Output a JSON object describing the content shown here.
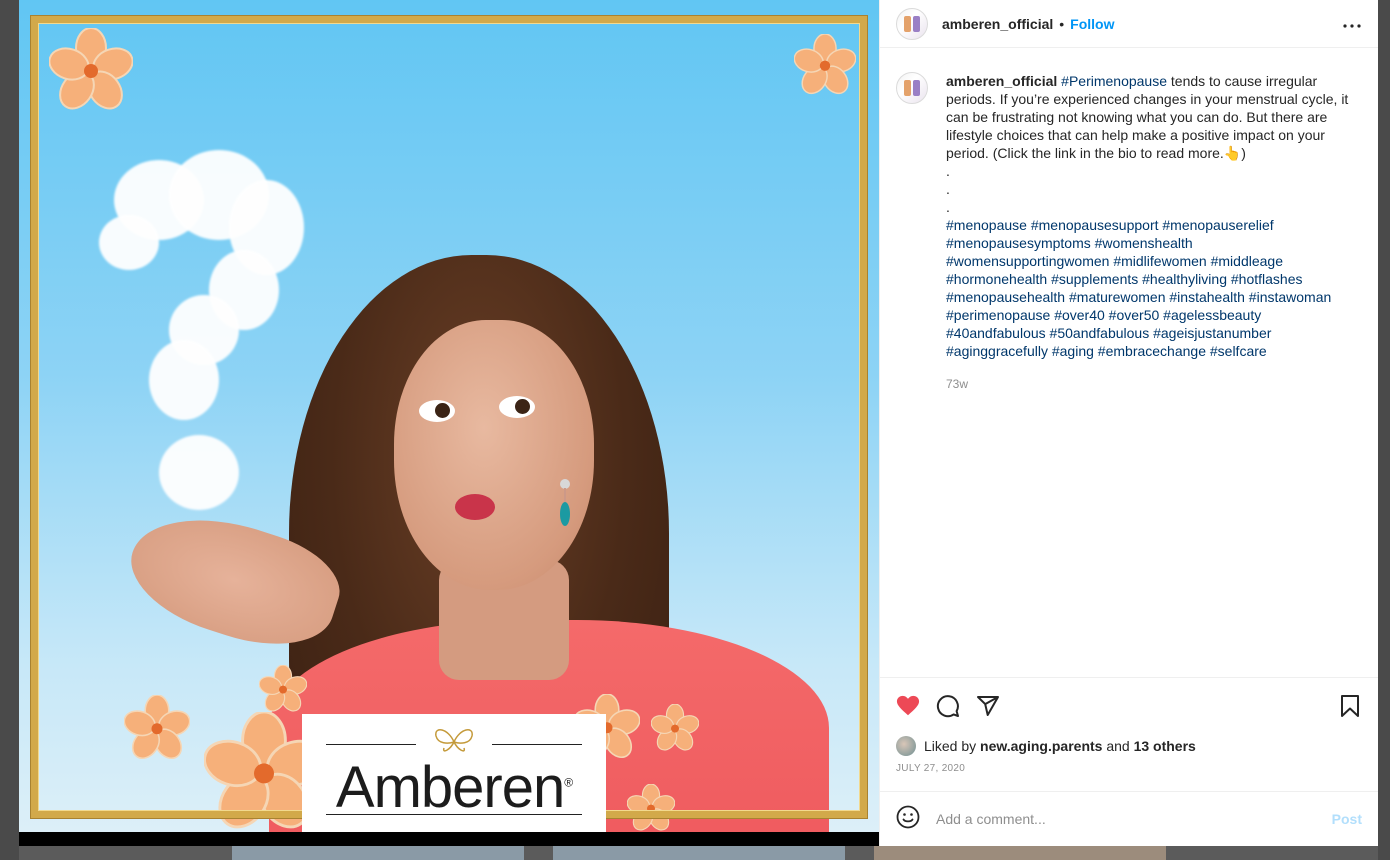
{
  "post": {
    "username": "amberen_official",
    "separator": "•",
    "follow_label": "Follow",
    "more_label": "•••",
    "brand": "Amberen",
    "brand_mark": "®"
  },
  "caption": {
    "username": "amberen_official",
    "lead_hashtag": "#Perimenopause",
    "text": " tends to cause irregular periods. If you’re experienced changes in your menstrual cycle, it can be frustrating not knowing what you can do. But there are lifestyle choices that can help make a positive impact on your period. (Click the link in the bio to read more.👆)",
    "dots": [
      ".",
      ".",
      "."
    ],
    "hashtags": [
      "#menopause",
      "#menopausesupport",
      "#menopauserelief",
      "#menopausesymptoms",
      "#womenshealth",
      "#womensupportingwomen",
      "#midlifewomen",
      "#middleage",
      "#hormonehealth",
      "#supplements",
      "#healthyliving",
      "#hotflashes",
      "#menopausehealth",
      "#maturewomen",
      "#instahealth",
      "#instawoman",
      "#perimenopause",
      "#over40",
      "#over50",
      "#agelessbeauty",
      "#40andfabulous",
      "#50andfabulous",
      "#ageisjustanumber",
      "#aginggracefully",
      "#aging",
      "#embracechange",
      "#selfcare"
    ],
    "time_ago": "73w"
  },
  "likes": {
    "prefix": "Liked by",
    "user": "new.aging.parents",
    "middle": "and",
    "others": "13 others"
  },
  "date": "July 27, 2020",
  "comment": {
    "placeholder": "Add a comment...",
    "post_label": "Post"
  },
  "colors": {
    "link_blue": "#0095f6",
    "hashtag": "#00376b",
    "heart": "#ed4956",
    "post_disabled": "#b2dffc"
  },
  "icons": [
    "heart-icon",
    "comment-icon",
    "share-icon",
    "bookmark-icon",
    "emoji-icon",
    "more-options-icon"
  ]
}
